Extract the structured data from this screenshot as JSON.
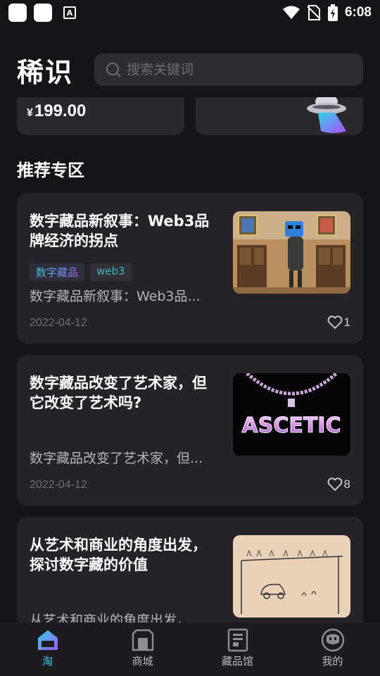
{
  "status_bar": {
    "time": "6:08",
    "a_badge": "A"
  },
  "header": {
    "logo": "稀识",
    "search_placeholder": "搜索关键词"
  },
  "top_cards": {
    "price_symbol": "¥",
    "price": "199.00"
  },
  "section": {
    "title": "推荐专区"
  },
  "articles": [
    {
      "title": "数字藏品新叙事：Web3品牌经济的拐点",
      "tags": [
        "数字藏品",
        "web3"
      ],
      "summary": "数字藏品新叙事：Web3品...",
      "date": "2022-04-12",
      "likes": "1"
    },
    {
      "title": "数字藏品改变了艺术家，但它改变了艺术吗?",
      "tags": [],
      "summary": "数字藏品改变了艺术家，但...",
      "date": "2022-04-12",
      "likes": "8",
      "thumb_text": "ASCETIC"
    },
    {
      "title": "从艺术和商业的角度出发，探讨数字藏的价值",
      "tags": [],
      "summary": "从艺术和商业的角度出发，...",
      "date": "",
      "likes": ""
    }
  ],
  "nav": [
    {
      "label": "淘",
      "icon": "home-icon",
      "active": true
    },
    {
      "label": "商城",
      "icon": "store-icon",
      "active": false
    },
    {
      "label": "藏品馆",
      "icon": "collection-icon",
      "active": false
    },
    {
      "label": "我的",
      "icon": "profile-icon",
      "active": false
    }
  ],
  "colors": {
    "accent": "#2fd3e6",
    "background": "#151517",
    "card": "#242428"
  }
}
